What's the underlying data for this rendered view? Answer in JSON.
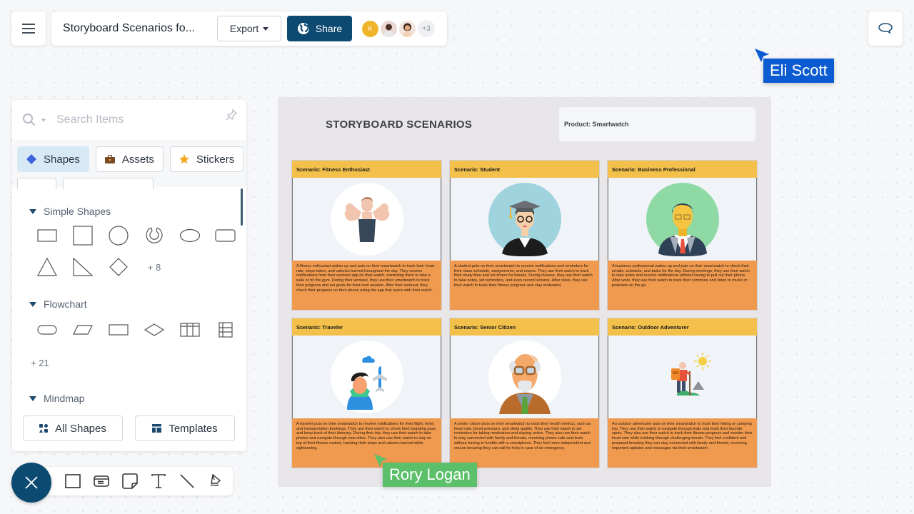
{
  "header": {
    "menu_icon": "hamburger-icon",
    "document_title": "Storyboard Scenarios fo...",
    "export_label": "Export",
    "share_label": "Share",
    "share_icon": "globe-icon",
    "collaborators": [
      {
        "initial": "K",
        "color": "#f0b429"
      },
      {
        "type": "photo",
        "color": "#c9a18a"
      },
      {
        "type": "photo",
        "color": "#e6b48f"
      }
    ],
    "more_collaborators": "+3",
    "comment_icon": "comment-icon"
  },
  "cursors": [
    {
      "name": "Eli Scott",
      "color": "#0b5bd3"
    },
    {
      "name": "Rory Logan",
      "color": "#5cbf6a"
    }
  ],
  "panel": {
    "search_placeholder": "Search Items",
    "tabs": [
      {
        "label": "Shapes",
        "icon": "diamond-icon",
        "active": true
      },
      {
        "label": "Assets",
        "icon": "briefcase-icon",
        "active": false
      },
      {
        "label": "Stickers",
        "icon": "star-icon",
        "active": false
      }
    ],
    "sections": [
      {
        "title": "Simple Shapes",
        "shapes": [
          "rectangle",
          "square",
          "circle",
          "arc-ring",
          "ellipse",
          "rounded-rectangle",
          "triangle",
          "right-triangle",
          "diamond"
        ],
        "more": "+ 8"
      },
      {
        "title": "Flowchart",
        "shapes": [
          "terminator",
          "parallelogram",
          "process",
          "decision",
          "table-columns",
          "table-rows"
        ],
        "more": "+ 21"
      },
      {
        "title": "Mindmap"
      }
    ],
    "footer": {
      "all_shapes": "All Shapes",
      "templates": "Templates"
    }
  },
  "toolbar": {
    "close_icon": "close-icon",
    "tools": [
      "rectangle-tool",
      "card-tool",
      "sticky-note-tool",
      "text-tool",
      "line-tool",
      "pen-tool"
    ]
  },
  "board": {
    "title": "STORYBOARD SCENARIOS",
    "product": "Product: Smartwatch",
    "colors": {
      "header": "#f3c14b",
      "body": "#ef9a4f"
    },
    "scenarios": [
      {
        "title": "Scenario: Fitness Enthusiast",
        "illustration": "fitness-person-illustration",
        "text": "A fitness enthusiast wakes up and puts on their smartwatch to track their heart rate, steps taken, and calories burned throughout the day. They receive notifications from their workout app on their watch, reminding them to take a walk or hit the gym. During their workout, they use their smartwatch to track their progress and set goals for their next session. After their workout, they check their progress on their phone using the app that syncs with their watch."
      },
      {
        "title": "Scenario: Student",
        "illustration": "graduate-student-illustration",
        "text": "A student puts on their smartwatch to receive notifications and reminders for their class schedule, assignments, and exams. They use their watch to track their study time and set timers for breaks. During classes, they use their watch to take notes, set reminders, and even record lectures. After class, they use their watch to track their fitness progress and stay motivated."
      },
      {
        "title": "Scenario: Business Professional",
        "illustration": "business-man-illustration",
        "text": "A business professional wakes up and puts on their smartwatch to check their emails, schedule, and tasks for the day. During meetings, they use their watch to take notes and receive notifications without having to pull out their phone. After work, they use their watch to track their commute and listen to music or podcasts on the go."
      },
      {
        "title": "Scenario: Traveler",
        "illustration": "traveler-illustration",
        "text": "A traveler puts on their smartwatch to receive notifications for their flight, hotel, and transportation bookings. They use their watch to check their boarding pass and keep track of their itinerary. During their trip, they use their watch to take photos and navigate through new cities. They also use their watch to stay on top of their fitness routine, tracking their steps and calories burned while sightseeing."
      },
      {
        "title": "Scenario: Senior Citizen",
        "illustration": "senior-man-illustration",
        "text": "A senior citizen puts on their smartwatch to track their health metrics, such as heart rate, blood pressure, and sleep quality. They use their watch to set reminders for taking medication and staying active. They also use their watch to stay connected with family and friends, receiving phone calls and texts without having to fumble with a smartphone. They feel more independent and secure knowing they can call for help in case of an emergency."
      },
      {
        "title": "Scenario: Outdoor Adventurer",
        "illustration": "hiker-illustration",
        "text": "An outdoor adventurer puts on their smartwatch to track their hiking or camping trip. They use their watch to navigate through trails and mark their favorite spots. They also use their watch to track their fitness progress and monitor their heart rate while trekking through challenging terrain. They feel confident and prepared knowing they can stay connected with family and friends, receiving important updates and messages via their smartwatch."
      }
    ]
  }
}
